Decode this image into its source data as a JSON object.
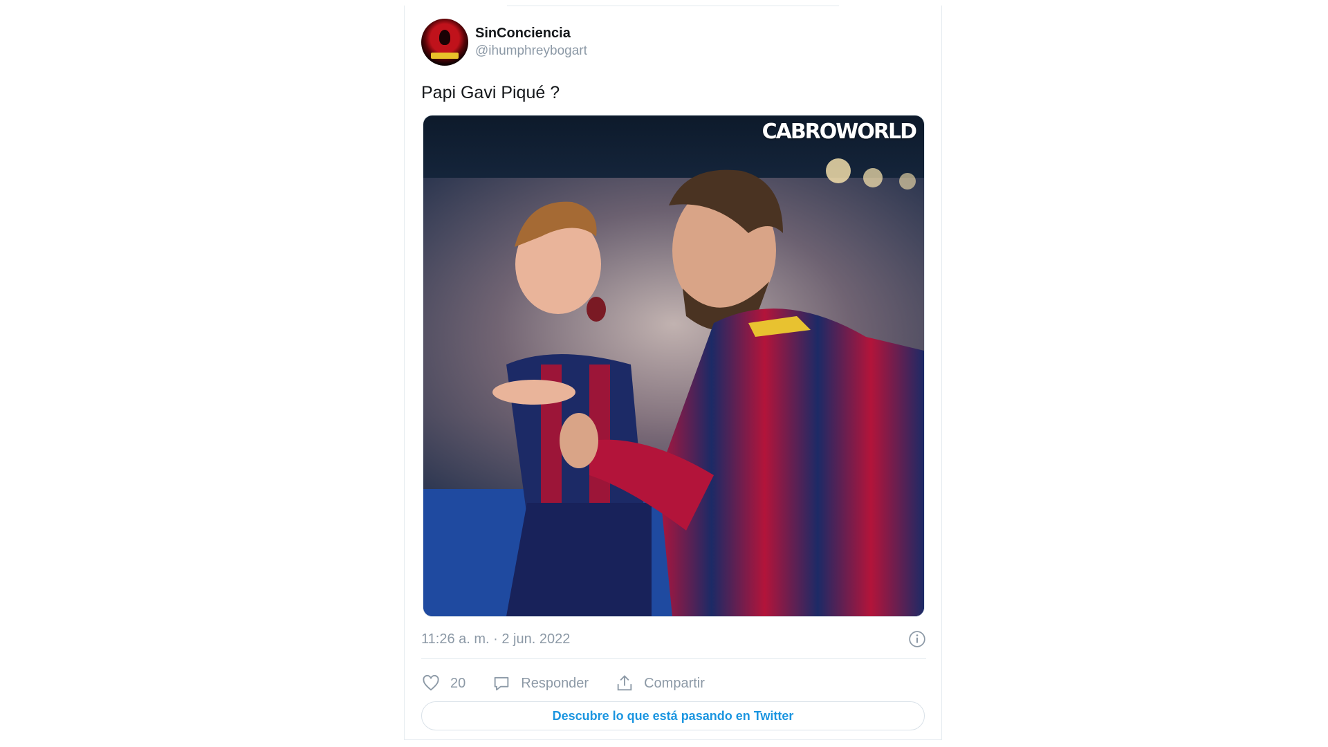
{
  "tweet": {
    "author": {
      "display_name": "SinConciencia",
      "handle": "@ihumphreybogart",
      "avatar_icon": "avatar-image"
    },
    "text": "Papi Gavi Piqué ?",
    "media": {
      "watermark": "CABROWORLD",
      "description_icon": "photo-image"
    },
    "timestamp": "11:26 a. m. · 2 jun. 2022",
    "info_icon": "info-icon",
    "actions": {
      "like_count": "20",
      "reply_label": "Responder",
      "share_label": "Compartir"
    },
    "discover_label": "Descubre lo que está pasando en Twitter"
  },
  "colors": {
    "link_blue": "#1b95e0",
    "muted_gray": "#8c99a6",
    "border": "#e1e8ed"
  }
}
